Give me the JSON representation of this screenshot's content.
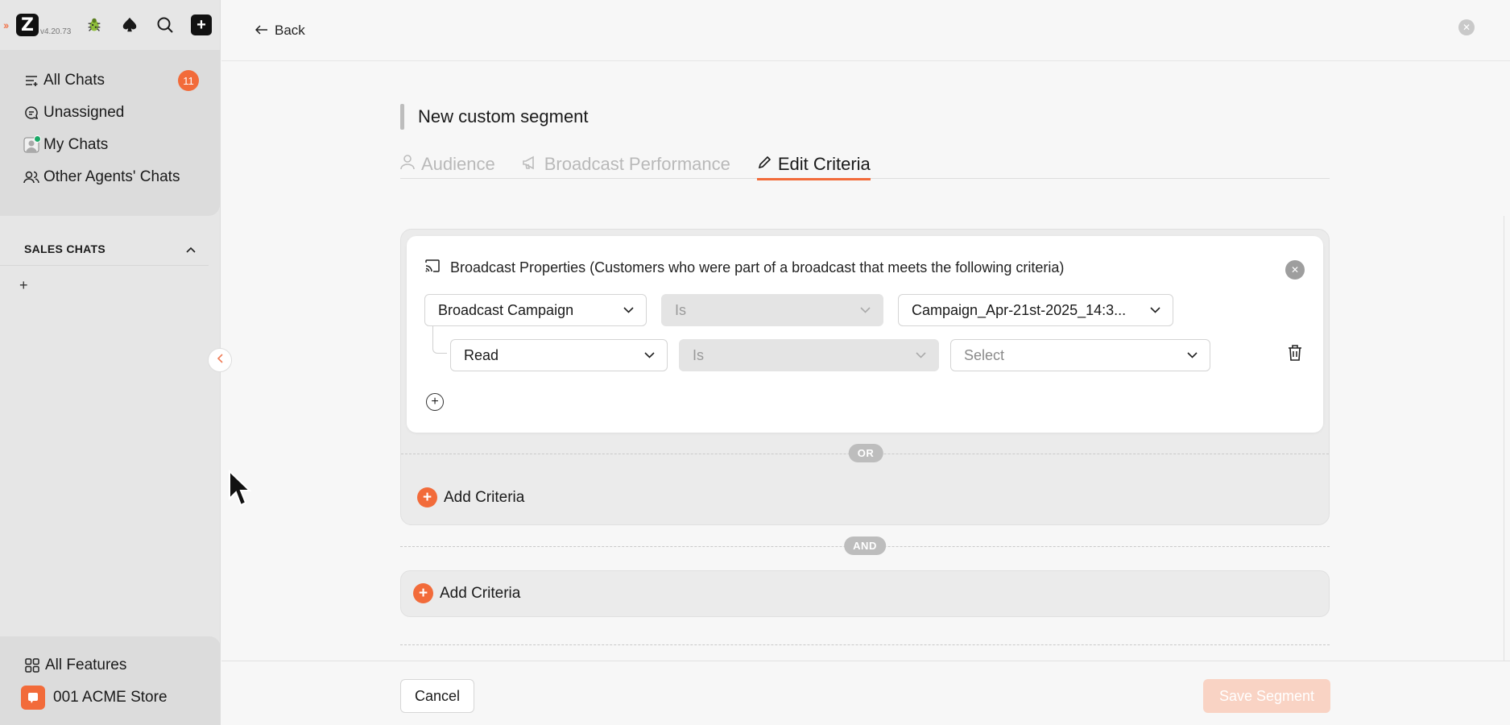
{
  "app": {
    "version": "v4.20.73",
    "logo_letter": "Z",
    "accent": "#f26b3a"
  },
  "sidebar": {
    "top_icons": [
      "bug-icon",
      "spade-icon",
      "search-icon",
      "plus-square-icon"
    ],
    "nav": [
      {
        "label": "All Chats",
        "icon": "inbox-list-icon",
        "badge": "11"
      },
      {
        "label": "Unassigned",
        "icon": "chat-bubble-icon"
      },
      {
        "label": "My Chats",
        "icon": "agent-avatar-icon",
        "online": true
      },
      {
        "label": "Other Agents' Chats",
        "icon": "users-icon"
      }
    ],
    "section": {
      "title": "SALES CHATS",
      "add": "+"
    },
    "bottom": {
      "features_label": "All Features",
      "store_label": "001 ACME Store"
    }
  },
  "header": {
    "back_label": "Back"
  },
  "segment": {
    "title": "New custom segment",
    "tabs": [
      {
        "label": "Audience",
        "icon": "user-icon",
        "active": false
      },
      {
        "label": "Broadcast Performance",
        "icon": "megaphone-icon",
        "active": false
      },
      {
        "label": "Edit Criteria",
        "icon": "pencil-icon",
        "active": true
      }
    ]
  },
  "criteria": {
    "group_title": "Broadcast Properties (Customers who were part of a broadcast that meets the following criteria)",
    "row1": {
      "field": "Broadcast Campaign",
      "operator": "Is",
      "value": "Campaign_Apr-21st-2025_14:3..."
    },
    "row2": {
      "field": "Read",
      "operator": "Is",
      "value_placeholder": "Select"
    },
    "or_label": "OR",
    "and_label": "AND",
    "add_criteria_label": "Add Criteria"
  },
  "footer": {
    "cancel_label": "Cancel",
    "save_label": "Save Segment"
  }
}
